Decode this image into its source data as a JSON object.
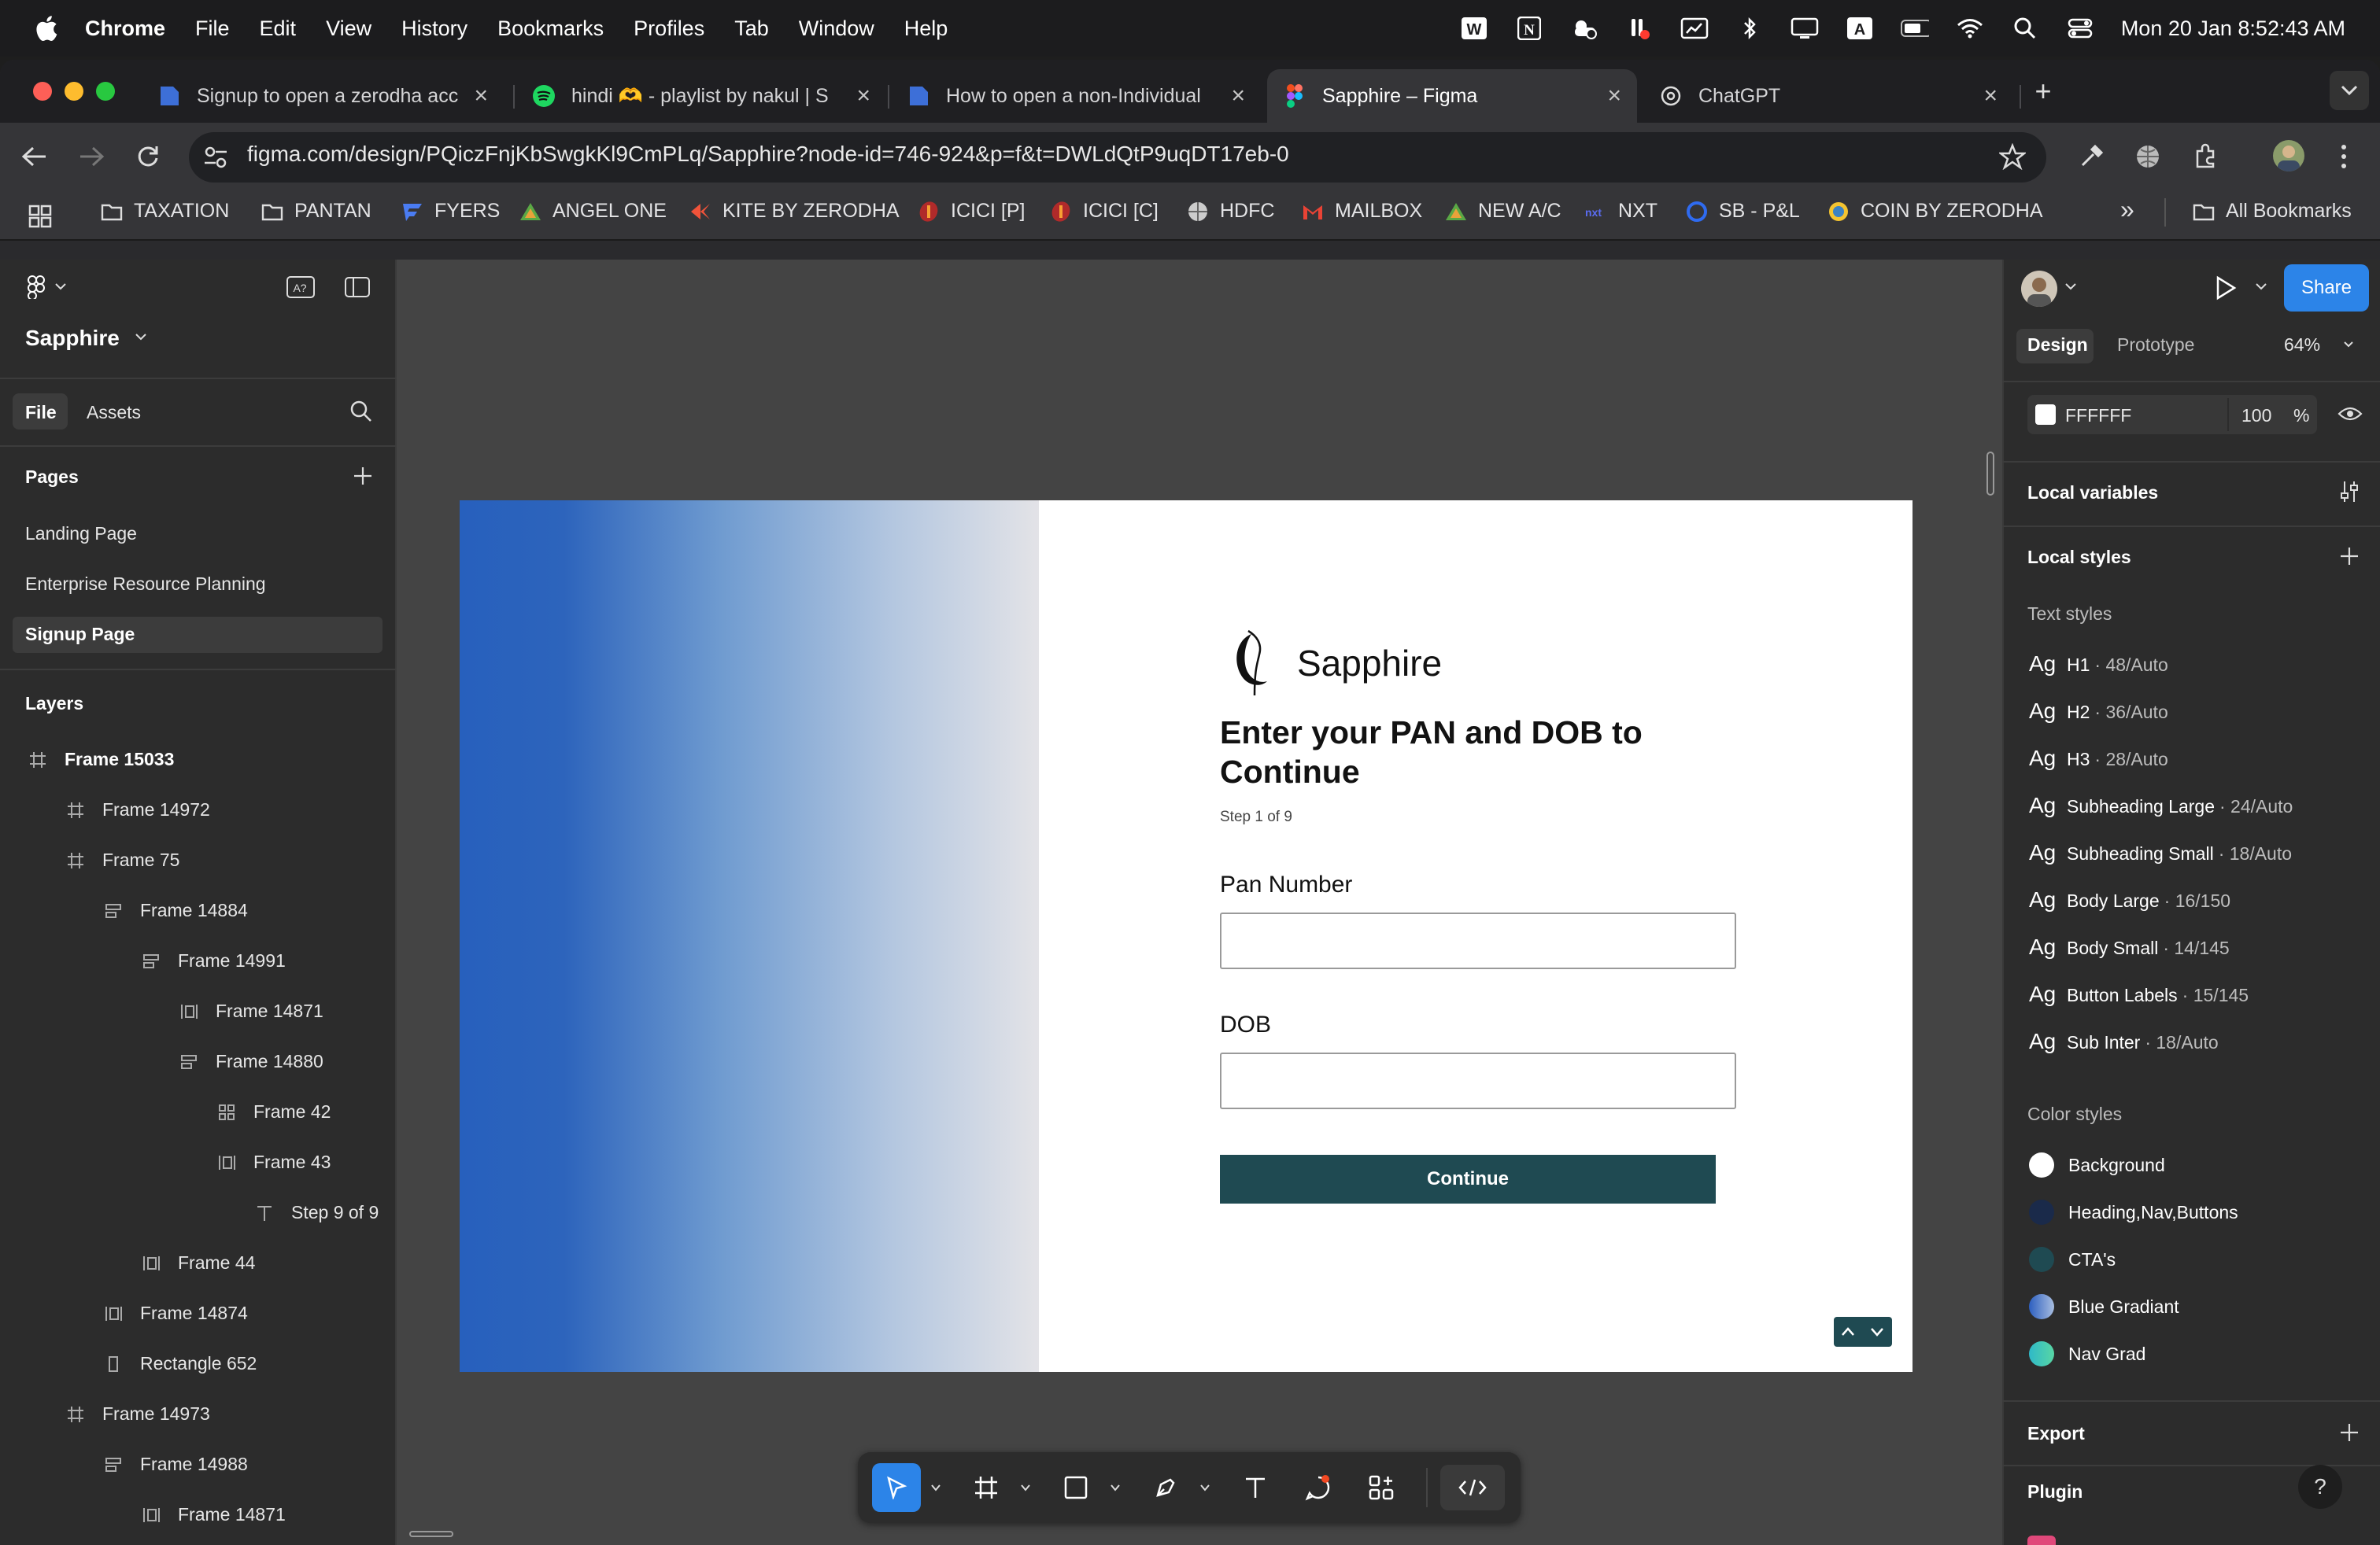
{
  "menubar": {
    "app": "Chrome",
    "items": [
      "File",
      "Edit",
      "View",
      "History",
      "Bookmarks",
      "Profiles",
      "Tab",
      "Window",
      "Help"
    ],
    "clock": "Mon 20 Jan  8:52:43 AM",
    "status_icons": [
      "word-icon",
      "notion-icon",
      "weather-icon",
      "app-alert-icon",
      "screen-icon",
      "bluetooth-icon",
      "display-icon",
      "keyboard-a-icon",
      "battery-icon",
      "wifi-icon",
      "search-icon",
      "control-center-icon"
    ]
  },
  "tabs": [
    {
      "title": "Signup to open a zerodha acc",
      "icon": "docs-icon"
    },
    {
      "title": "hindi 🫶 - playlist by nakul | S",
      "icon": "spotify-icon"
    },
    {
      "title": "How to open a non-Individual",
      "icon": "docs-icon"
    },
    {
      "title": "Sapphire – Figma",
      "icon": "figma-icon",
      "active": true
    },
    {
      "title": "ChatGPT",
      "icon": "chatgpt-icon"
    }
  ],
  "address": {
    "url": "figma.com/design/PQiczFnjKbSwgkKl9CmPLq/Sapphire?node-id=746-924&p=f&t=DWLdQtP9uqDT17eb-0"
  },
  "bookmarks": {
    "items": [
      "TAXATION",
      "PANTAN",
      "FYERS",
      "ANGEL ONE",
      "KITE BY ZERODHA",
      "ICICI [P]",
      "ICICI [C]",
      "HDFC",
      "MAILBOX",
      "NEW A/C",
      "NXT",
      "SB - P&L",
      "COIN BY ZERODHA"
    ],
    "more": "»",
    "all": "All Bookmarks"
  },
  "figma": {
    "file_name": "Sapphire",
    "tabs": {
      "file": "File",
      "assets": "Assets"
    },
    "pages_label": "Pages",
    "pages": [
      "Landing Page",
      "Enterprise Resource Planning",
      "Signup Page"
    ],
    "layers_label": "Layers",
    "layers": [
      {
        "name": "Frame 15033",
        "icon": "frame"
      },
      {
        "name": "Frame 14972",
        "icon": "frame"
      },
      {
        "name": "Frame 75",
        "icon": "frame"
      },
      {
        "name": "Frame 14884",
        "icon": "autolayout-v"
      },
      {
        "name": "Frame 14991",
        "icon": "autolayout-v"
      },
      {
        "name": "Frame 14871",
        "icon": "autolayout-h"
      },
      {
        "name": "Frame 14880",
        "icon": "autolayout-v"
      },
      {
        "name": "Frame 42",
        "icon": "grid"
      },
      {
        "name": "Frame 43",
        "icon": "autolayout-h"
      },
      {
        "name": "Step 9 of 9",
        "icon": "text"
      },
      {
        "name": "Frame 44",
        "icon": "autolayout-h"
      },
      {
        "name": "Frame 14874",
        "icon": "autolayout-h"
      },
      {
        "name": "Rectangle 652",
        "icon": "rect"
      },
      {
        "name": "Frame 14973",
        "icon": "frame"
      },
      {
        "name": "Frame 14988",
        "icon": "autolayout-v"
      },
      {
        "name": "Frame 14871",
        "icon": "autolayout-h"
      }
    ],
    "right": {
      "share": "Share",
      "tab_design": "Design",
      "tab_prototype": "Prototype",
      "zoom": "64%",
      "bg_hex": "FFFFFF",
      "bg_opacity": "100",
      "percent": "%",
      "local_variables": "Local variables",
      "local_styles": "Local styles",
      "text_styles_label": "Text styles",
      "text_styles": [
        {
          "name": "H1",
          "sub": "· 48/Auto"
        },
        {
          "name": "H2",
          "sub": "· 36/Auto"
        },
        {
          "name": "H3",
          "sub": "· 28/Auto"
        },
        {
          "name": "Subheading Large",
          "sub": "· 24/Auto"
        },
        {
          "name": "Subheading Small",
          "sub": "· 18/Auto"
        },
        {
          "name": "Body Large",
          "sub": "· 16/150"
        },
        {
          "name": "Body Small",
          "sub": "· 14/145"
        },
        {
          "name": "Button Labels",
          "sub": "· 15/145"
        },
        {
          "name": "Sub Inter",
          "sub": "· 18/Auto"
        }
      ],
      "ag": "Ag",
      "color_styles_label": "Color styles",
      "color_styles": [
        {
          "name": "Background",
          "color": "#ffffff"
        },
        {
          "name": "Heading,Nav,Buttons",
          "color": "#1a2a4a"
        },
        {
          "name": "CTA's",
          "color": "#1f4a52"
        },
        {
          "name": "Blue Gradiant",
          "color": "#3b6fd0"
        },
        {
          "name": "Nav Grad",
          "color": "#3fc6c0"
        }
      ],
      "export": "Export",
      "plugin": "Plugin",
      "help": "?"
    },
    "frame": {
      "logo_text": "Sapphire",
      "heading_line1": "Enter your PAN and DOB to",
      "heading_line2": "Continue",
      "step": "Step 1 of 9",
      "pan_label": "Pan Number",
      "dob_label": "DOB",
      "continue": "Continue"
    }
  },
  "colors": {
    "accent": "#2c84e8",
    "cta": "#1f4a52"
  }
}
